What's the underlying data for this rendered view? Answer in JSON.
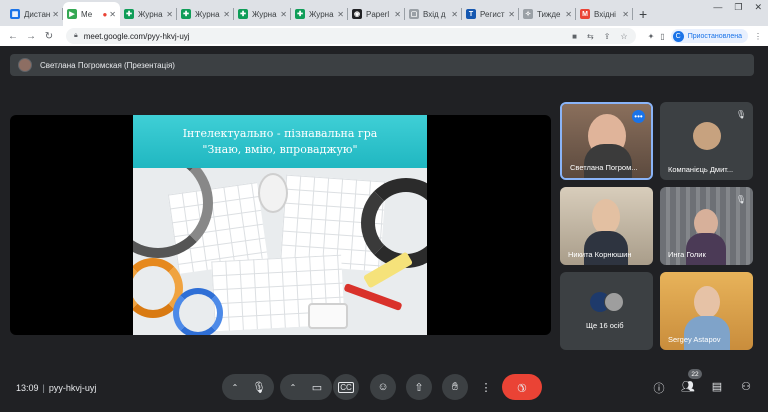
{
  "browser": {
    "tabs": [
      {
        "label": "Дистан",
        "color": "#1a73e8",
        "glyph": "▦"
      },
      {
        "label": "Ме",
        "color": "#34a853",
        "glyph": "▶",
        "active": true,
        "recording": true
      },
      {
        "label": "Журна",
        "color": "#0f9d58",
        "glyph": "✚"
      },
      {
        "label": "Журна",
        "color": "#0f9d58",
        "glyph": "✚"
      },
      {
        "label": "Журна",
        "color": "#0f9d58",
        "glyph": "✚"
      },
      {
        "label": "Журна",
        "color": "#0f9d58",
        "glyph": "✚"
      },
      {
        "label": "Paperl",
        "color": "#202124",
        "glyph": "◉"
      },
      {
        "label": "Вхід д",
        "color": "#9aa0a6",
        "glyph": "▢"
      },
      {
        "label": "Регист",
        "color": "#1557b0",
        "glyph": "T"
      },
      {
        "label": "Тижде",
        "color": "#9aa0a6",
        "glyph": "✧"
      },
      {
        "label": "Вхідні",
        "color": "#ea4335",
        "glyph": "M"
      }
    ],
    "new_tab": "+",
    "url": "meet.google.com/pyy-hkvj-uyj",
    "paused_label": "Приостановлена",
    "paused_initial": "С"
  },
  "presenter": {
    "label": "Светлана Погромская (Презентація)"
  },
  "slide": {
    "line1": "Інтелектуально - пізнавальна гра",
    "line2": "\"Знаю, вмію, впроваджую\""
  },
  "participants": [
    {
      "name": "Светлана Погром...",
      "state": "more"
    },
    {
      "name": "Компанієць Дмит...",
      "state": "muted"
    },
    {
      "name": "Никита Корнюшин",
      "state": "none"
    },
    {
      "name": "Инга Голик",
      "state": "muted"
    },
    {
      "name": "Ще 16 осіб",
      "state": "none"
    },
    {
      "name": "Sergey Astapov",
      "state": "none"
    }
  ],
  "meeting": {
    "time": "13:09",
    "separator": "|",
    "code": "pyy-hkvj-uyj",
    "people_count": "22"
  },
  "icons": {
    "mic": "mic-icon",
    "camera": "camera-icon",
    "captions": "captions-icon",
    "emoji": "emoji-icon",
    "present": "present-icon",
    "hand": "raise-hand-icon",
    "more": "more-options-icon",
    "end": "end-call-icon",
    "info": "info-icon",
    "people": "people-icon",
    "chat": "chat-icon",
    "activities": "activities-icon"
  },
  "colors": {
    "end_call": "#ea4335",
    "accent": "#1a73e8",
    "slide_header": "#20b7c1"
  }
}
